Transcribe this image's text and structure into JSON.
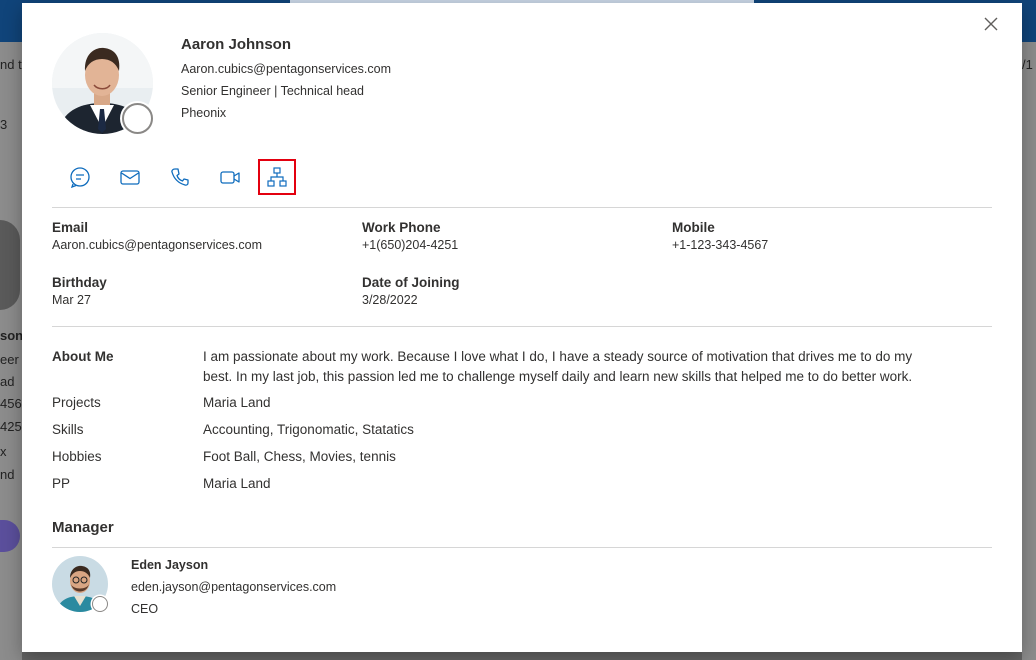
{
  "background": {
    "left_fragments": [
      "nd t",
      "3",
      "son",
      "eer",
      "ad",
      "456",
      "425",
      "x",
      "nd"
    ],
    "right_fragments": [
      "/1"
    ]
  },
  "dialog": {
    "close_icon": "close-icon",
    "profile": {
      "name": "Aaron Johnson",
      "email": "Aaron.cubics@pentagonservices.com",
      "title": "Senior Engineer | Technical head",
      "location": "Pheonix",
      "presence": "offline"
    },
    "actions": [
      {
        "icon": "chat-icon"
      },
      {
        "icon": "mail-icon"
      },
      {
        "icon": "phone-icon"
      },
      {
        "icon": "video-icon"
      },
      {
        "icon": "org-chart-icon",
        "selected": true
      }
    ],
    "contact": {
      "email_label": "Email",
      "email_value": "Aaron.cubics@pentagonservices.com",
      "work_phone_label": "Work Phone",
      "work_phone_value": "+1(650)204-4251",
      "mobile_label": "Mobile",
      "mobile_value": "+1-123-343-4567",
      "birthday_label": "Birthday",
      "birthday_value": "Mar 27",
      "doj_label": "Date of Joining",
      "doj_value": "3/28/2022"
    },
    "about": {
      "about_label": "About Me",
      "about_line1": "I am passionate about my work. Because I love what I do, I have a steady source of motivation that drives me to do my",
      "about_line2": "best. In my last job, this passion led me to challenge myself daily and learn new skills that helped me to do better work.",
      "projects_label": "Projects",
      "projects_value": "Maria Land",
      "skills_label": "Skills",
      "skills_value": "Accounting, Trigonomatic, Statatics",
      "hobbies_label": "Hobbies",
      "hobbies_value": "Foot Ball, Chess, Movies, tennis",
      "pp_label": "PP",
      "pp_value": "Maria Land"
    },
    "manager": {
      "section_title": "Manager",
      "name": "Eden Jayson",
      "email": "eden.jayson@pentagonservices.com",
      "title": "CEO"
    }
  },
  "colors": {
    "accent": "#0f6cbd",
    "selected_border": "#e3000f",
    "topbar": "#10447a"
  }
}
